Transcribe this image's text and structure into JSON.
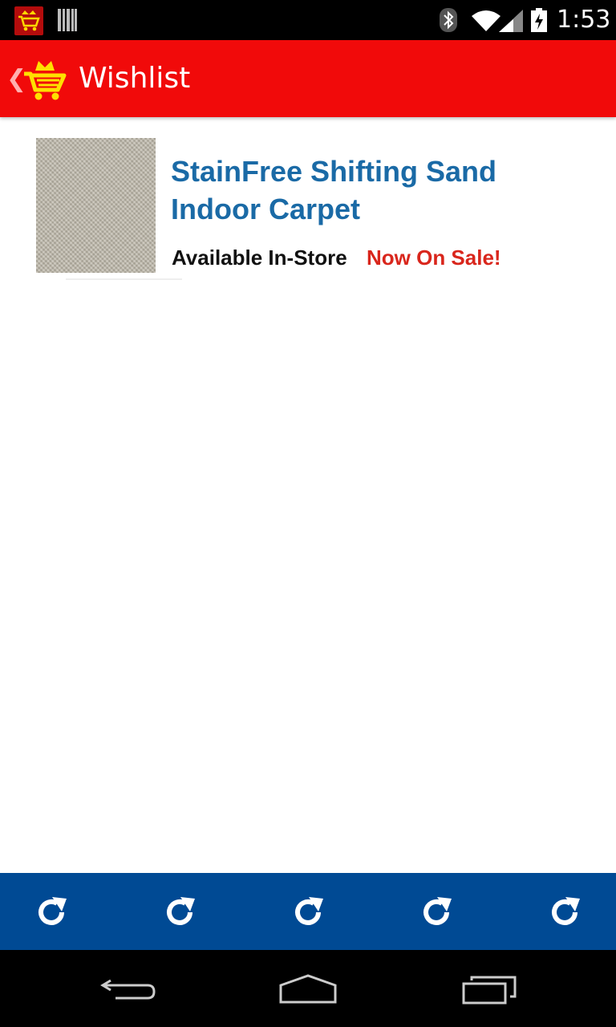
{
  "status_bar": {
    "time": "1:53",
    "icons": [
      "app-notification-icon",
      "barcode-icon",
      "bluetooth-icon",
      "wifi-icon",
      "signal-icon",
      "battery-icon"
    ]
  },
  "action_bar": {
    "title": "Wishlist",
    "back_glyph": "❮",
    "background_color": "#f10a0a"
  },
  "wishlist": {
    "items": [
      {
        "title": "StainFree Shifting Sand Indoor Carpet",
        "availability": "Available In-Store",
        "sale": "Now On Sale!"
      }
    ]
  },
  "bottom_toolbar": {
    "background_color": "#004a94",
    "buttons": [
      "refresh-icon",
      "refresh-icon",
      "refresh-icon",
      "refresh-icon",
      "refresh-icon"
    ]
  },
  "nav_bar": {
    "buttons": [
      "back-icon",
      "home-icon",
      "recents-icon"
    ]
  }
}
